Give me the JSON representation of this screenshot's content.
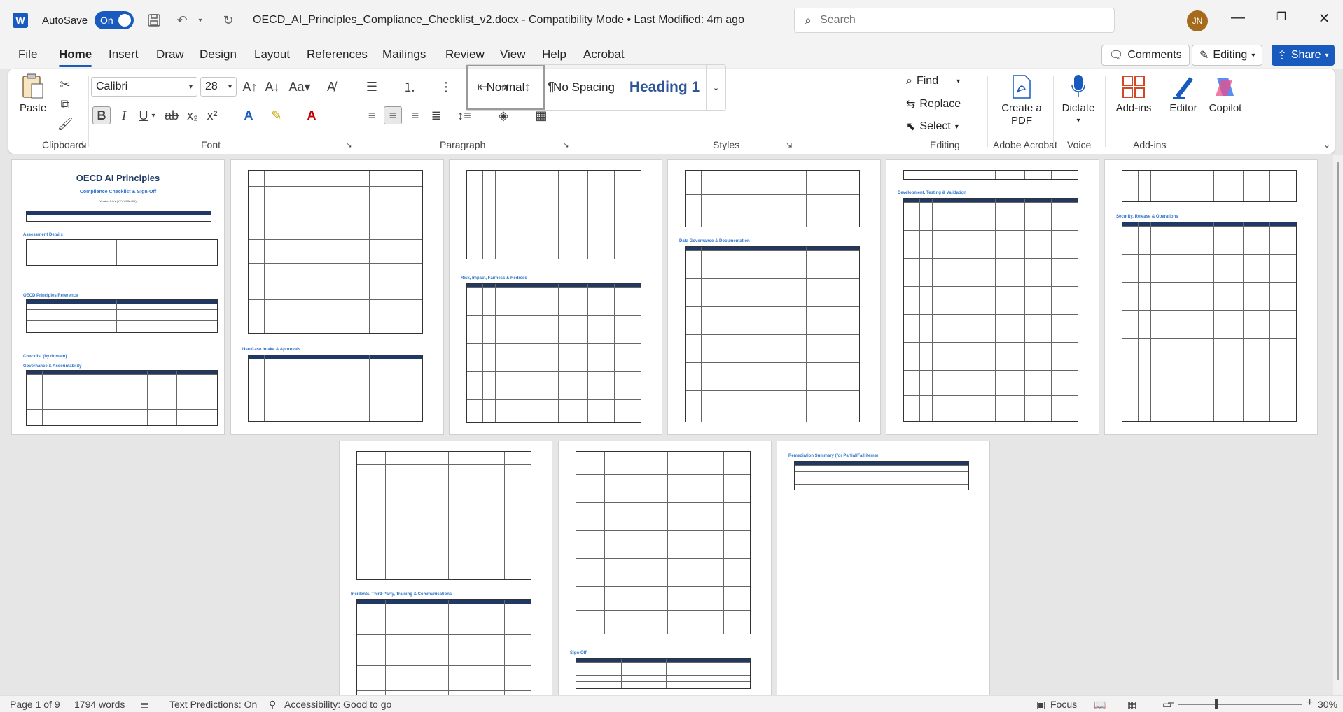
{
  "titlebar": {
    "autosave_label": "AutoSave",
    "autosave_state": "On",
    "doc_title": "OECD_AI_Principles_Compliance_Checklist_v2.docx  -  Compatibility Mode  •  Last Modified: 4m ago",
    "search_placeholder": "Search",
    "avatar_initials": "JN"
  },
  "menu": {
    "tabs": [
      "File",
      "Home",
      "Insert",
      "Draw",
      "Design",
      "Layout",
      "References",
      "Mailings",
      "Review",
      "View",
      "Help",
      "Acrobat"
    ],
    "active_tab": "Home",
    "comments_label": "Comments",
    "editing_label": "Editing",
    "share_label": "Share"
  },
  "ribbon": {
    "clipboard": {
      "paste": "Paste",
      "label": "Clipboard"
    },
    "font": {
      "name": "Calibri",
      "size": "28",
      "label": "Font"
    },
    "paragraph": {
      "label": "Paragraph"
    },
    "styles": {
      "items": [
        "Normal",
        "No Spacing",
        "Heading 1"
      ],
      "label": "Styles"
    },
    "editing": {
      "find": "Find",
      "replace": "Replace",
      "select": "Select",
      "label": "Editing"
    },
    "acrobat": {
      "create_pdf": "Create a PDF",
      "label": "Adobe Acrobat"
    },
    "voice": {
      "dictate": "Dictate",
      "label": "Voice"
    },
    "addins": {
      "addins": "Add-ins",
      "editor": "Editor",
      "copilot": "Copilot",
      "label": "Add-ins"
    }
  },
  "document": {
    "page1": {
      "title": "OECD AI Principles",
      "subtitle": "Compliance Checklist & Sign-Off",
      "version": "Version 0.0/v (YYYY-MM-DD)",
      "sections": [
        "Assessment Details",
        "OECD Principles Reference",
        "Checklist (by domain)",
        "Governance & Accountability"
      ]
    },
    "page2_heading": "Use-Case Intake & Approvals",
    "page3_heading": "Risk, Impact, Fairness & Redress",
    "page4_heading": "Data Governance & Documentation",
    "page5_heading": "Development, Testing & Validation",
    "page6_heading": "Security, Release & Operations",
    "page7_heading": "Incidents, Third-Party, Training & Communications",
    "page8_heading": "Sign-Off",
    "page9_heading": "Remediation Summary (for Partial/Fail items)"
  },
  "statusbar": {
    "page": "Page 1 of 9",
    "words": "1794 words",
    "text_predictions": "Text Predictions: On",
    "accessibility": "Accessibility: Good to go",
    "focus": "Focus",
    "zoom": "30%"
  },
  "colors": {
    "accent": "#185abd",
    "heading_navy": "#1f3864",
    "heading_blue": "#2f74c7"
  }
}
